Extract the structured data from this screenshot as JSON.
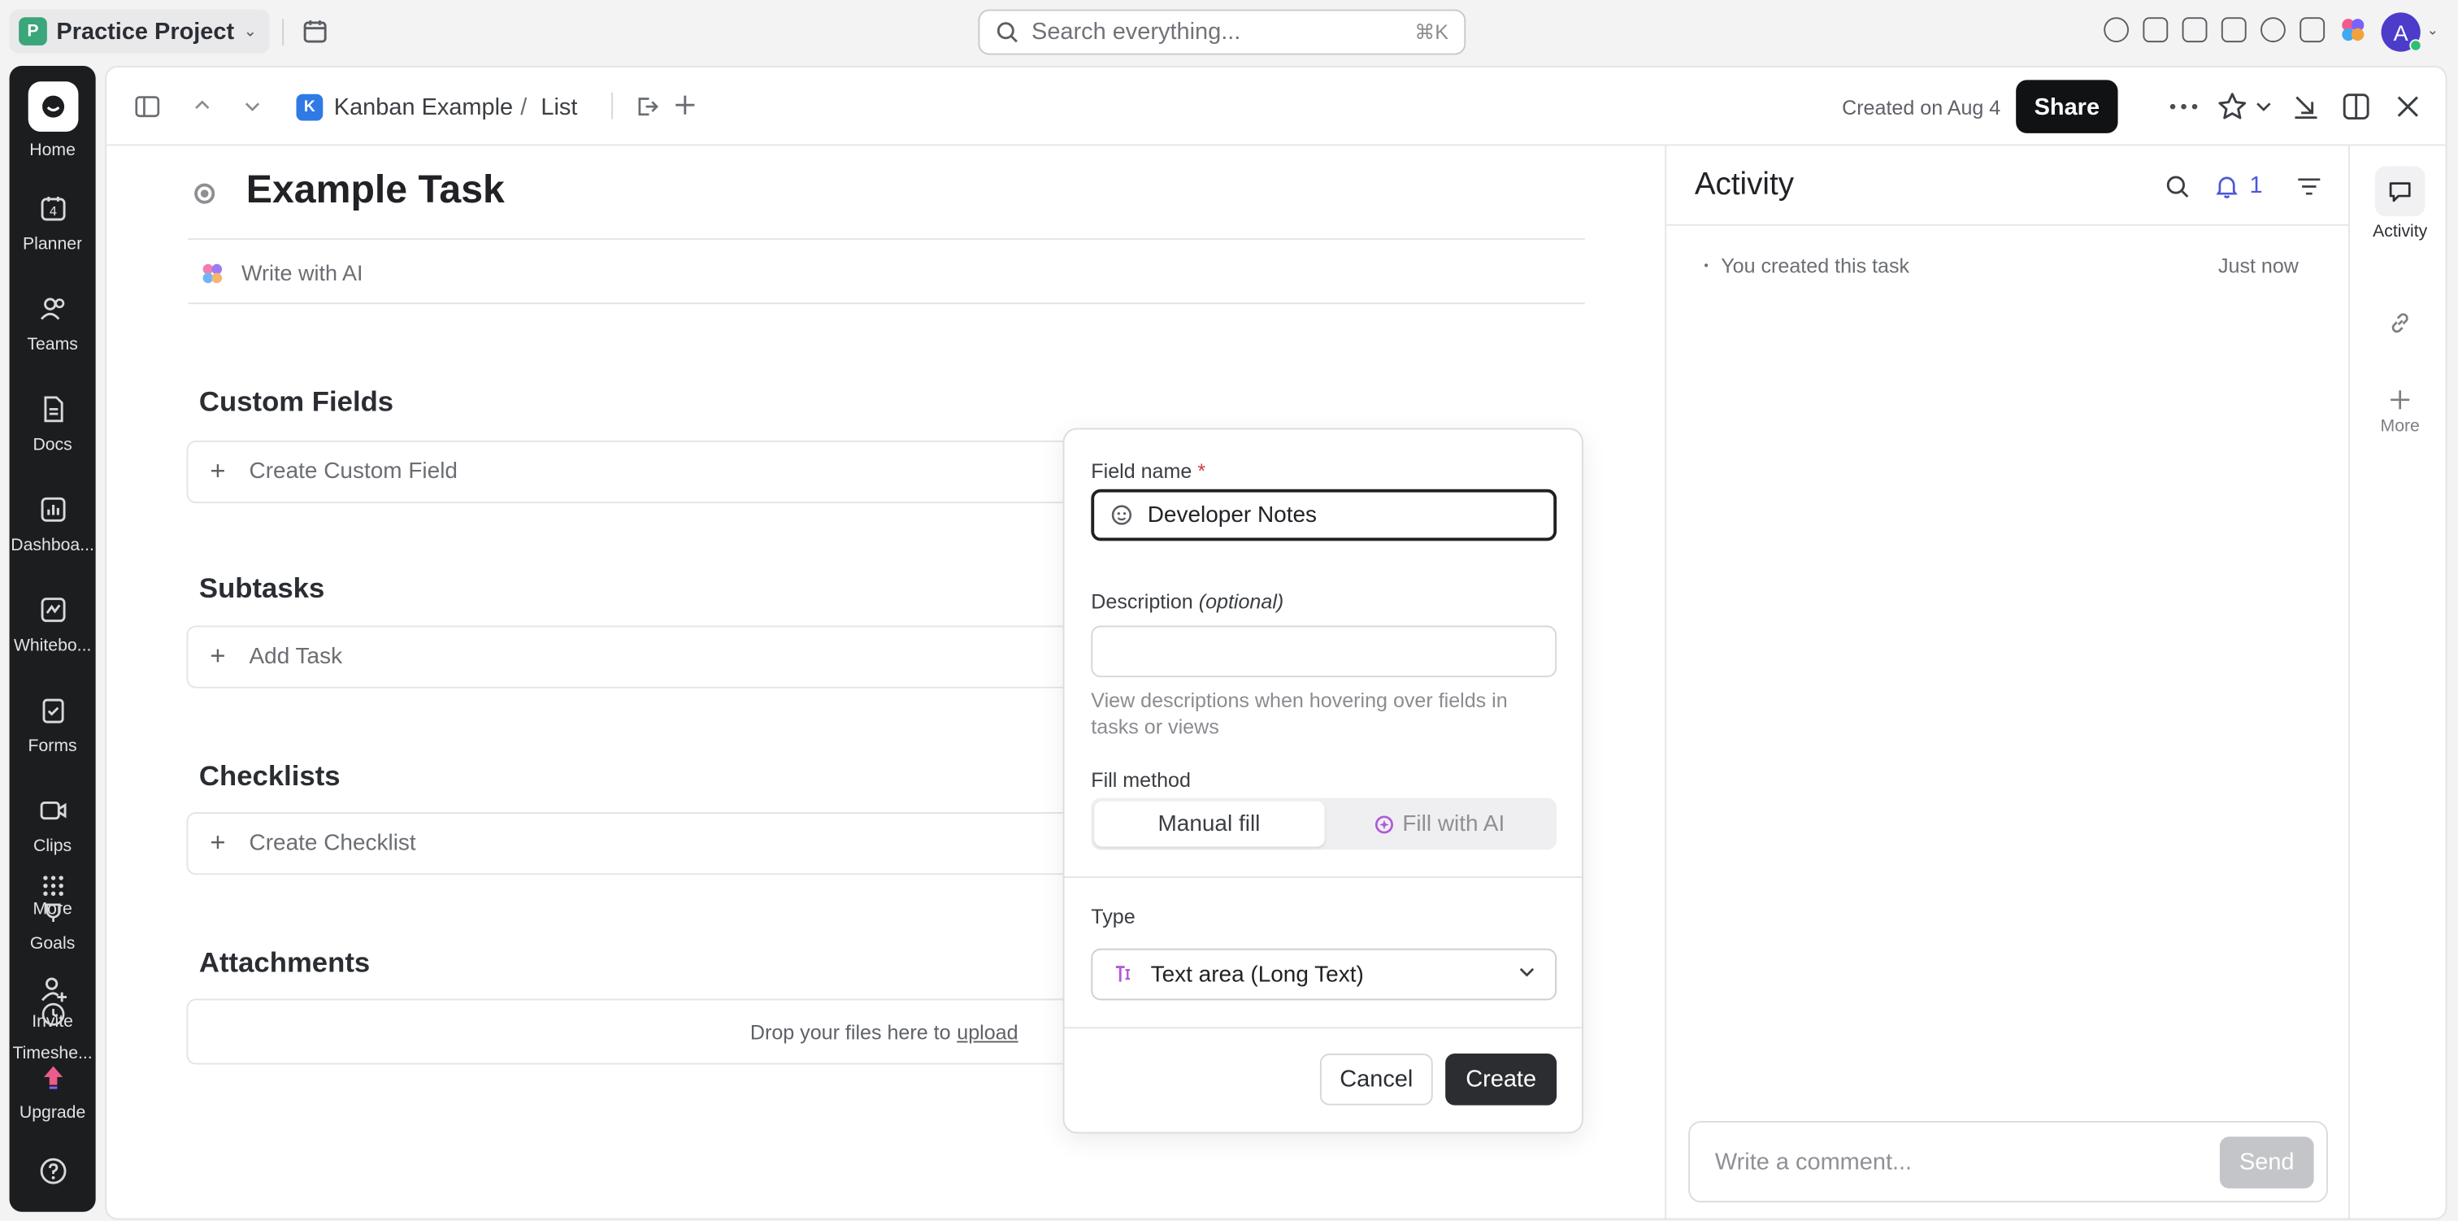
{
  "workspace": {
    "initial": "P",
    "name": "Practice Project"
  },
  "search": {
    "placeholder": "Search everything...",
    "shortcut": "⌘K"
  },
  "user": {
    "initial": "A"
  },
  "rail": {
    "items": [
      {
        "label": "Home"
      },
      {
        "label": "Planner",
        "badge": "4"
      },
      {
        "label": "Teams"
      },
      {
        "label": "Docs"
      },
      {
        "label": "Dashboa..."
      },
      {
        "label": "Whitebo..."
      },
      {
        "label": "Forms"
      },
      {
        "label": "Clips"
      },
      {
        "label": "More"
      },
      {
        "label": "Goals"
      },
      {
        "label": "Invite"
      },
      {
        "label": "Timeshe..."
      },
      {
        "label": "Upgrade"
      }
    ]
  },
  "header": {
    "space_initial": "K",
    "breadcrumb_space": "Kanban Example",
    "breadcrumb_sep": "/",
    "breadcrumb_list": "List",
    "created": "Created on Aug 4",
    "share_label": "Share"
  },
  "task": {
    "title": "Example Task",
    "write_ai": "Write with AI"
  },
  "sections": {
    "custom_fields": {
      "title": "Custom Fields",
      "action": "Create Custom Field"
    },
    "subtasks": {
      "title": "Subtasks",
      "action": "Add Task"
    },
    "checklists": {
      "title": "Checklists",
      "action": "Create Checklist"
    },
    "attachments": {
      "title": "Attachments",
      "drop_text": "Drop your files here to",
      "upload_link": "upload"
    }
  },
  "popup": {
    "field_name_label": "Field name",
    "required_mark": "*",
    "field_name_value": "Developer Notes",
    "description_label": "Description",
    "description_optional": "(optional)",
    "description_value": "",
    "description_help": "View descriptions when hovering over fields in tasks or views",
    "fill_method_label": "Fill method",
    "fill_manual": "Manual fill",
    "fill_ai": "Fill with AI",
    "type_label": "Type",
    "type_value": "Text area (Long Text)",
    "cancel_label": "Cancel",
    "create_label": "Create"
  },
  "activity": {
    "title": "Activity",
    "notification_count": "1",
    "entry_text": "You created this task",
    "entry_time": "Just now",
    "comment_placeholder": "Write a comment...",
    "send_label": "Send"
  },
  "mini_rail": {
    "activity_label": "Activity",
    "more_label": "More"
  },
  "colors": {
    "accent": "#4a58d6",
    "dark_button": "#111213",
    "rail_bg": "#1c1d1f"
  }
}
